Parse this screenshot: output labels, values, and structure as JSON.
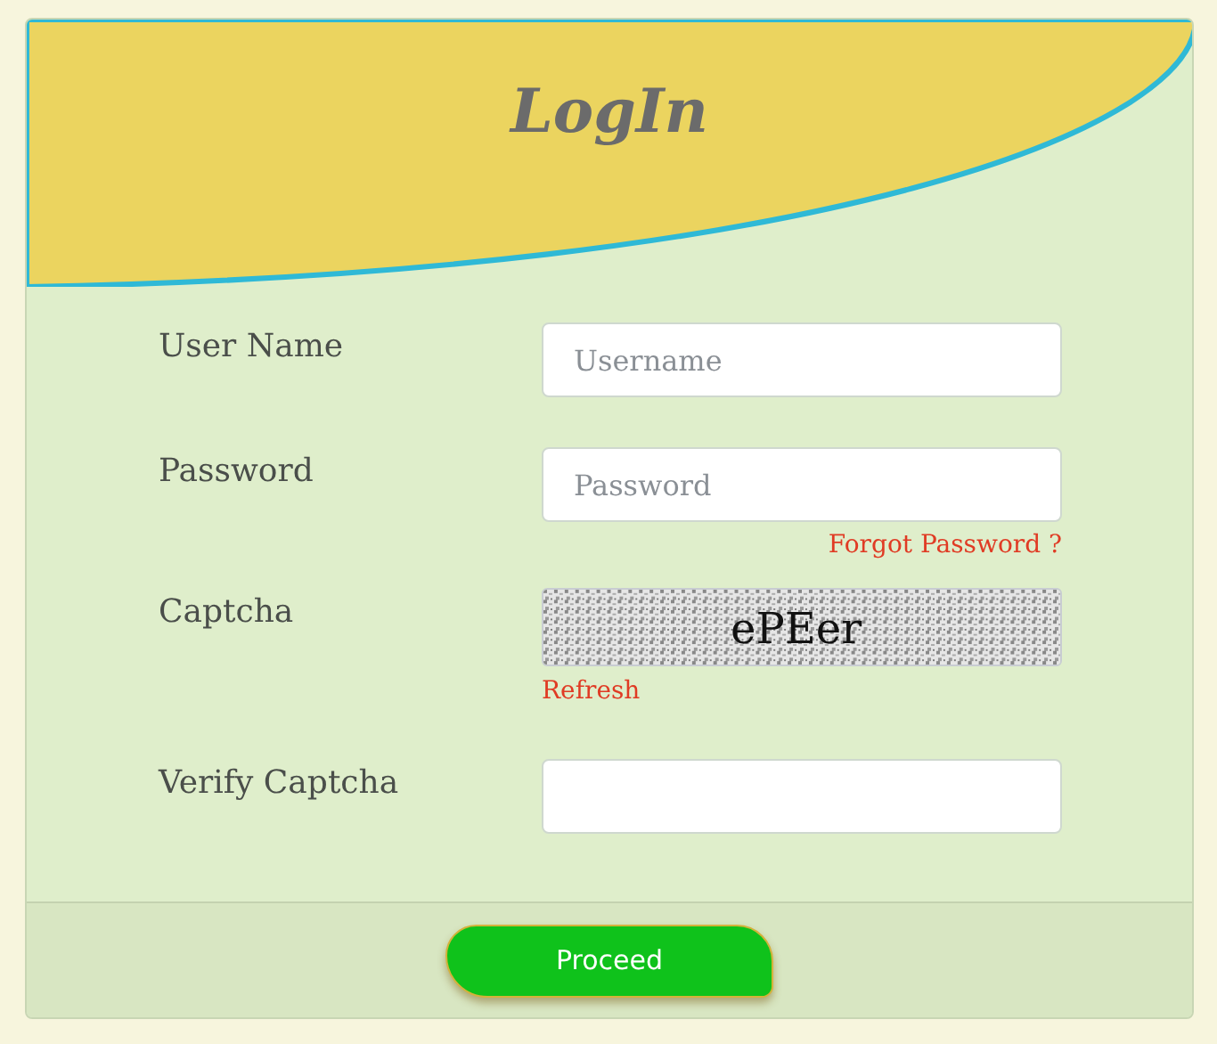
{
  "title": "LogIn",
  "fields": [
    {
      "label": "User Name",
      "kind": "text",
      "placeholder": "Username"
    },
    {
      "label": "Password",
      "kind": "password",
      "placeholder": "Password",
      "link": "Forgot Password ?"
    },
    {
      "label": "Captcha",
      "kind": "captcha",
      "captcha_text": "ePEer",
      "link": "Refresh"
    },
    {
      "label": "Verify Captcha",
      "kind": "text"
    }
  ],
  "button": "Proceed"
}
